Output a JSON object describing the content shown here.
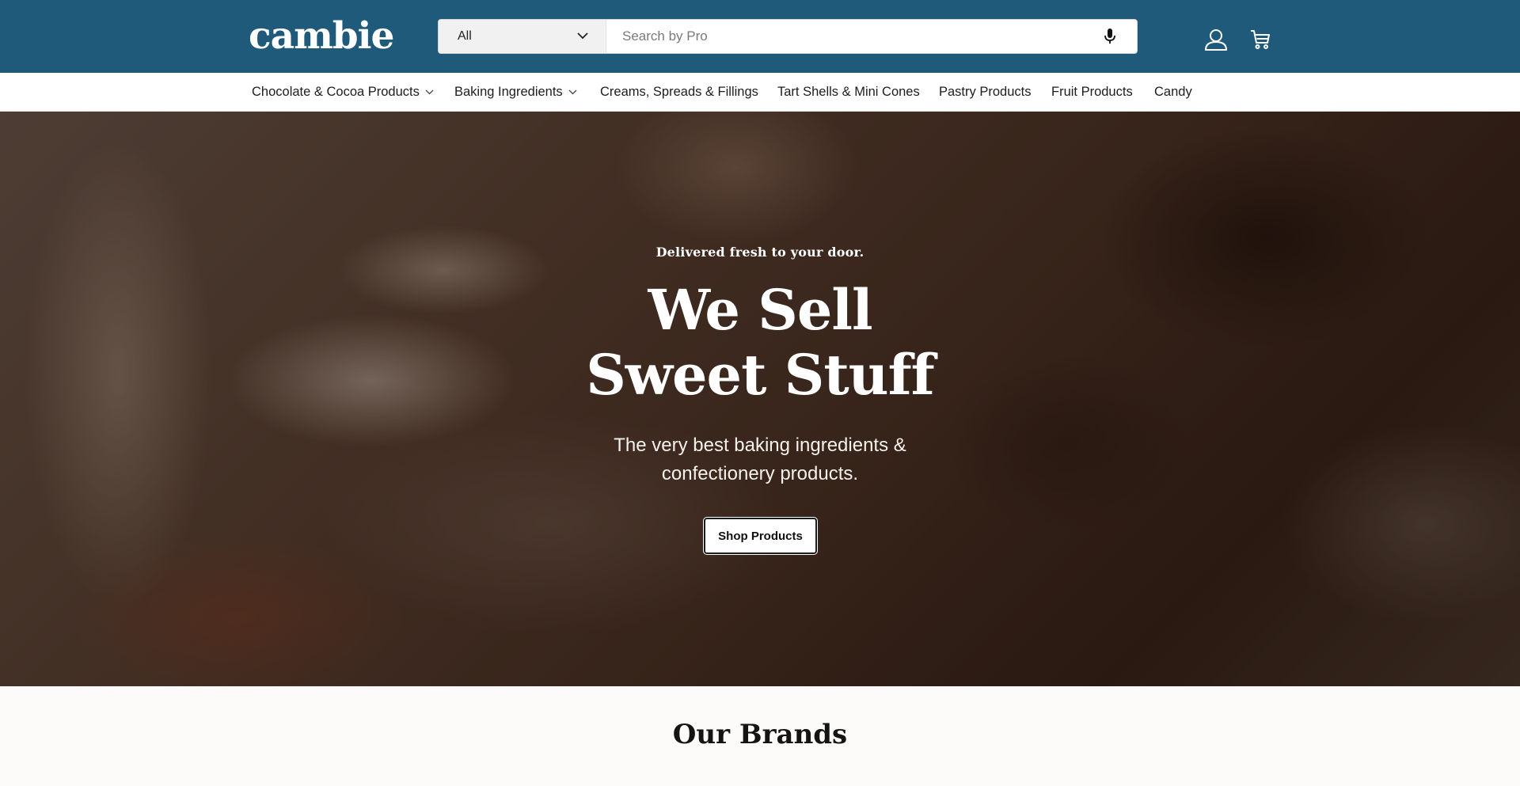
{
  "header": {
    "logo": "cambie",
    "search": {
      "category": "All",
      "placeholder": "Search by Pro"
    },
    "icons": {
      "mic": "microphone-icon",
      "account": "account-icon",
      "cart": "cart-icon"
    },
    "colors": {
      "background": "#1f5a7a"
    }
  },
  "nav": {
    "items": [
      {
        "label": "Chocolate & Cocoa Products",
        "dropdown": true
      },
      {
        "label": "Baking Ingredients",
        "dropdown": true
      },
      {
        "label": "Creams, Spreads & Fillings",
        "dropdown": false
      },
      {
        "label": "Tart Shells & Mini Cones",
        "dropdown": false
      },
      {
        "label": "Pastry Products",
        "dropdown": false
      },
      {
        "label": "Fruit Products",
        "dropdown": false
      },
      {
        "label": "Candy",
        "dropdown": false
      }
    ]
  },
  "hero": {
    "kicker": "Delivered fresh to your door.",
    "title_line1": "We Sell",
    "title_line2": "Sweet Stuff",
    "subtitle": "The very best baking ingredients & confectionery products.",
    "button_label": "Shop Products"
  },
  "brands": {
    "title": "Our Brands"
  }
}
